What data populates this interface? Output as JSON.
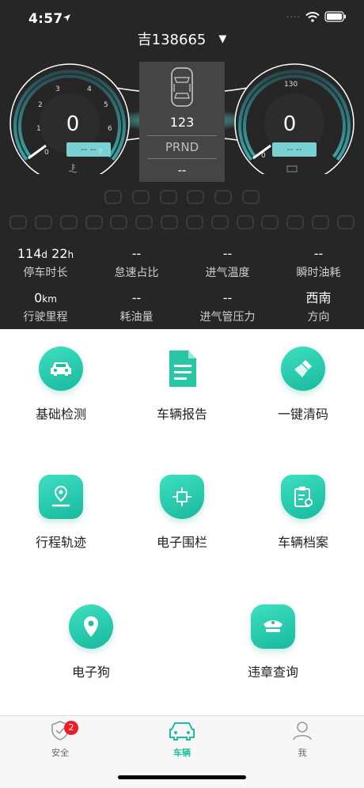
{
  "status_bar": {
    "time": "4:57",
    "dots": "····"
  },
  "header": {
    "plate": "吉138665",
    "caret": "▼"
  },
  "dashboard": {
    "left_gauge": {
      "value": "0",
      "bar_text": "-- --",
      "ticks": [
        "0",
        "1",
        "2",
        "3",
        "4",
        "5",
        "6",
        "7"
      ]
    },
    "right_gauge": {
      "value": "0",
      "bar_text": "-- --",
      "ticks": [
        "0",
        "130"
      ]
    },
    "center": {
      "speed": "123",
      "gear": "PRND",
      "value": "--"
    }
  },
  "stats": [
    {
      "value": "114",
      "unit": "d",
      "value2": " 22",
      "unit2": "h",
      "label": "停车时长"
    },
    {
      "value": "--",
      "label": "怠速占比"
    },
    {
      "value": "--",
      "label": "进气温度"
    },
    {
      "value": "--",
      "label": "瞬时油耗"
    },
    {
      "value": "0",
      "unit": "km",
      "label": "行驶里程"
    },
    {
      "value": "--",
      "label": "耗油量"
    },
    {
      "value": "--",
      "label": "进气管压力"
    },
    {
      "value": "西南",
      "label": "方向"
    }
  ],
  "features": [
    {
      "label": "基础检测",
      "icon": "car-icon"
    },
    {
      "label": "车辆报告",
      "icon": "document-icon"
    },
    {
      "label": "一键清码",
      "icon": "brush-icon"
    },
    {
      "label": "行程轨迹",
      "icon": "route-icon"
    },
    {
      "label": "电子围栏",
      "icon": "fence-icon"
    },
    {
      "label": "车辆档案",
      "icon": "clipboard-icon"
    },
    {
      "label": "电子狗",
      "icon": "location-pin-icon"
    },
    {
      "label": "违章查询",
      "icon": "police-cap-icon"
    }
  ],
  "tabs": [
    {
      "label": "安全",
      "badge": "2"
    },
    {
      "label": "车辆"
    },
    {
      "label": "我"
    }
  ],
  "colors": {
    "accent": "#1fbf9d",
    "dash_bg": "#262626",
    "badge": "#ee1c25"
  }
}
